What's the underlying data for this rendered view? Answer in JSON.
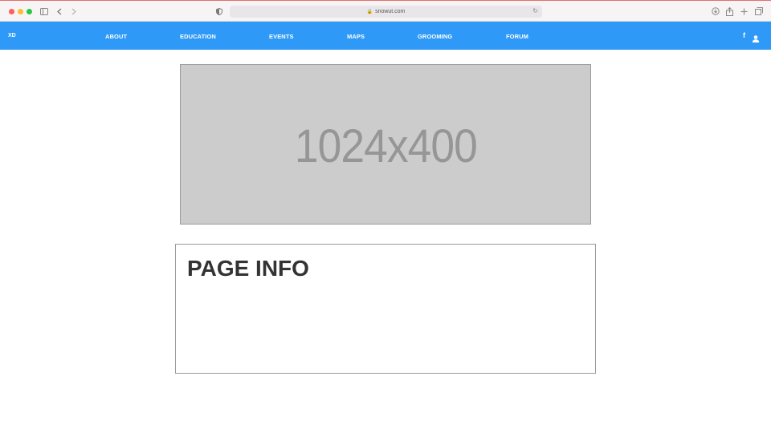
{
  "browser": {
    "url": "snowut.com"
  },
  "nav": {
    "logo": "XD",
    "items": [
      {
        "label": "ABOUT"
      },
      {
        "label": "EDUCATION"
      },
      {
        "label": "EVENTS"
      },
      {
        "label": "MAPS"
      },
      {
        "label": "GROOMING"
      },
      {
        "label": "FORUM"
      }
    ],
    "social": "f",
    "accent_color": "#2e99f7"
  },
  "hero": {
    "placeholder_text": "1024x400"
  },
  "info": {
    "title": "PAGE INFO"
  }
}
